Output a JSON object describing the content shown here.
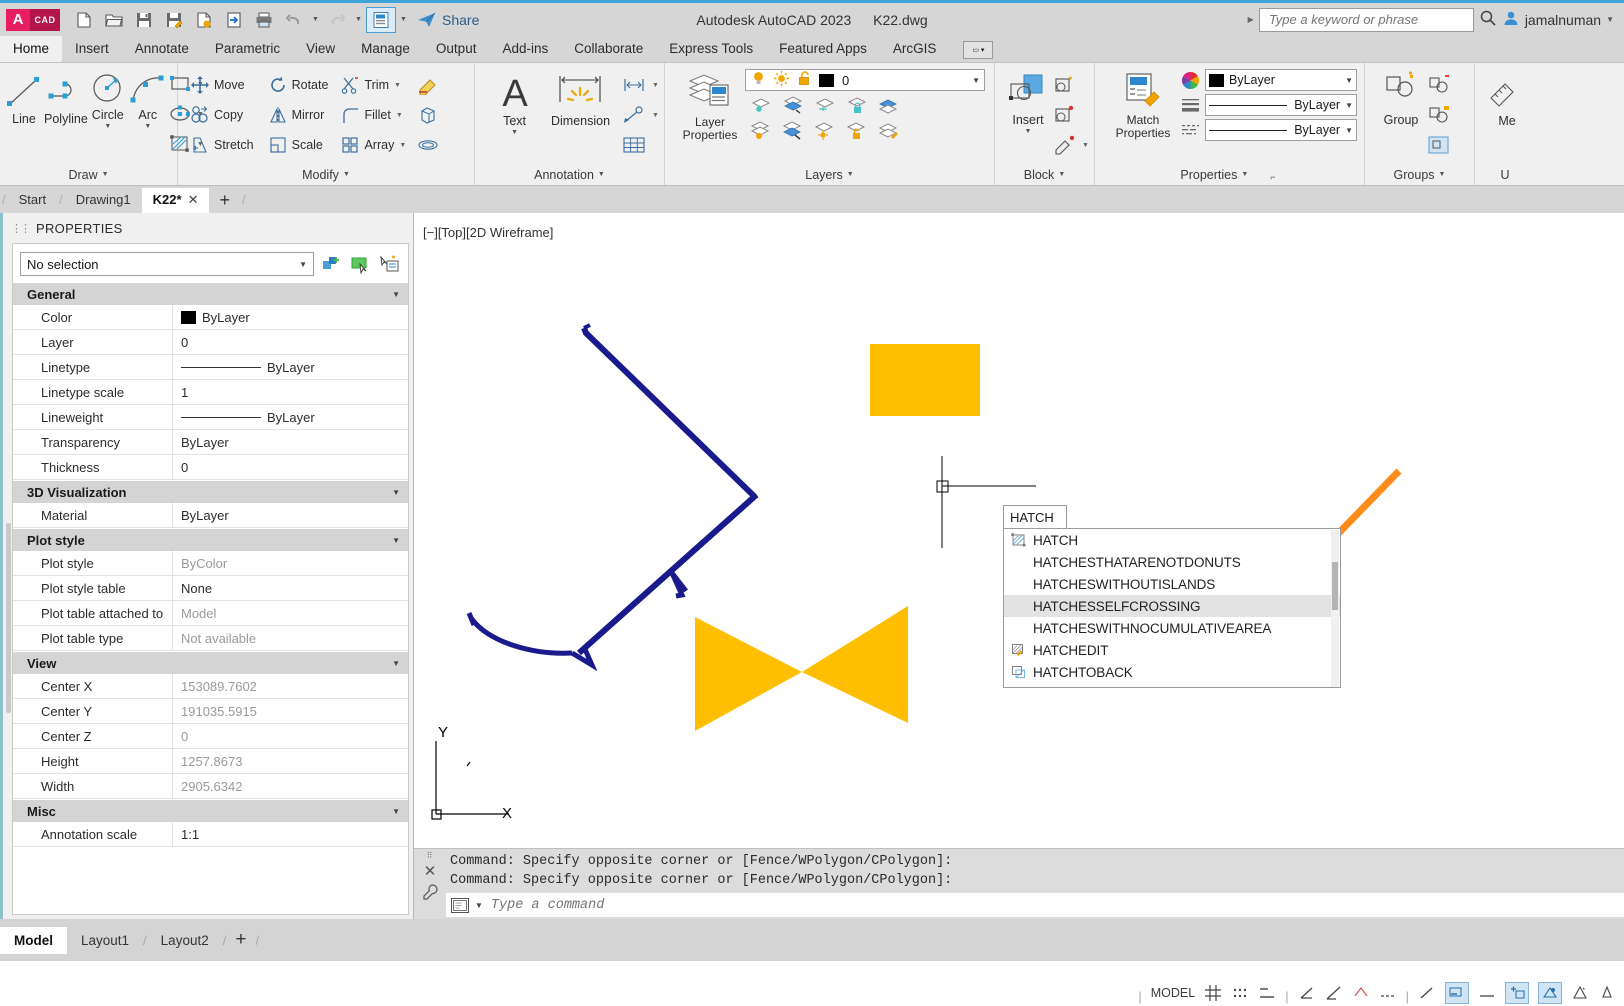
{
  "titlebar": {
    "app_name": "AutoCAD",
    "logo_a": "A",
    "logo_cad": "CAD",
    "title_app": "Autodesk AutoCAD 2023",
    "title_file": "K22.dwg",
    "share_label": "Share",
    "search_placeholder": "Type a keyword or phrase",
    "username": "jamalnuman",
    "quick_access": [
      {
        "name": "new-file-icon",
        "label": "New"
      },
      {
        "name": "open-file-icon",
        "label": "Open"
      },
      {
        "name": "save-icon",
        "label": "Save"
      },
      {
        "name": "save-as-icon",
        "label": "Save As"
      },
      {
        "name": "export-icon",
        "label": "Export"
      },
      {
        "name": "publish-icon",
        "label": "Publish"
      },
      {
        "name": "plot-icon",
        "label": "Plot"
      },
      {
        "name": "undo-icon",
        "label": "Undo"
      },
      {
        "name": "redo-icon",
        "label": "Redo"
      },
      {
        "name": "workspace-icon",
        "label": "Workspace Switching"
      }
    ]
  },
  "ribbon_tabs": [
    {
      "label": "Home",
      "active": true
    },
    {
      "label": "Insert",
      "active": false
    },
    {
      "label": "Annotate",
      "active": false
    },
    {
      "label": "Parametric",
      "active": false
    },
    {
      "label": "View",
      "active": false
    },
    {
      "label": "Manage",
      "active": false
    },
    {
      "label": "Output",
      "active": false
    },
    {
      "label": "Add-ins",
      "active": false
    },
    {
      "label": "Collaborate",
      "active": false
    },
    {
      "label": "Express Tools",
      "active": false
    },
    {
      "label": "Featured Apps",
      "active": false
    },
    {
      "label": "ArcGIS",
      "active": false
    }
  ],
  "ribbon": {
    "draw": {
      "title": "Draw",
      "big": [
        {
          "label": "Line",
          "icon": "line-icon",
          "has_caret": false
        },
        {
          "label": "Polyline",
          "icon": "polyline-icon",
          "has_caret": false
        },
        {
          "label": "Circle",
          "icon": "circle-icon",
          "has_caret": true
        },
        {
          "label": "Arc",
          "icon": "arc-icon",
          "has_caret": true
        }
      ],
      "small": [
        {
          "label": "",
          "icon": "rectangle-icon"
        },
        {
          "label": "",
          "icon": "ellipse-icon"
        },
        {
          "label": "",
          "icon": "hatch-icon"
        }
      ]
    },
    "modify": {
      "title": "Modify",
      "items": [
        {
          "label": "Move",
          "icon": "move-icon",
          "caret": false
        },
        {
          "label": "Rotate",
          "icon": "rotate-icon",
          "caret": false
        },
        {
          "label": "Trim",
          "icon": "trim-icon",
          "caret": true
        },
        {
          "label": "Copy",
          "icon": "copy-icon",
          "caret": false
        },
        {
          "label": "Mirror",
          "icon": "mirror-icon",
          "caret": false
        },
        {
          "label": "Fillet",
          "icon": "fillet-icon",
          "caret": true
        },
        {
          "label": "Stretch",
          "icon": "stretch-icon",
          "caret": false
        },
        {
          "label": "Scale",
          "icon": "scale-icon",
          "caret": false
        },
        {
          "label": "Array",
          "icon": "array-icon",
          "caret": true
        }
      ],
      "extra": [
        {
          "icon": "erase-icon"
        },
        {
          "icon": "extrude-icon"
        },
        {
          "icon": "offset-icon"
        }
      ]
    },
    "annotation": {
      "title": "Annotation",
      "text_label": "Text",
      "dimension_label": "Dimension",
      "small": [
        {
          "icon": "linear-dimension-icon",
          "caret": true
        },
        {
          "icon": "leader-icon",
          "caret": true
        },
        {
          "icon": "table-icon",
          "caret": false
        }
      ]
    },
    "layers": {
      "title": "Layers",
      "layer_properties_label": "Layer\nProperties",
      "current_layer": "0",
      "row1": [
        "layer-isolate-icon",
        "layer-freeze-icon",
        "layer-off-icon",
        "layer-lock-icon",
        "layer-make-current-icon"
      ],
      "row2": [
        "layer-on-icon",
        "layer-thaw-icon",
        "layer-unisolate-icon",
        "layer-unlock-icon",
        "layer-match-icon"
      ]
    },
    "block": {
      "title": "Block",
      "insert_label": "Insert",
      "small": [
        {
          "icon": "create-block-icon"
        },
        {
          "icon": "edit-block-icon"
        },
        {
          "icon": "edit-attribute-icon",
          "caret": true
        }
      ]
    },
    "properties": {
      "title": "Properties",
      "match_properties_label": "Match\nProperties",
      "color_value": "ByLayer",
      "linetype_value": "ByLayer",
      "lineweight_value": "ByLayer",
      "color_icon": "color-wheel-icon",
      "lineweight_icon": "lineweight-icon",
      "linetype_icon": "linetype-icon"
    },
    "groups": {
      "title": "Groups",
      "group_label": "Group",
      "small": [
        {
          "icon": "ungroup-icon"
        },
        {
          "icon": "group-edit-icon"
        },
        {
          "icon": "group-selection-icon"
        }
      ]
    },
    "utilities": {
      "title": "U",
      "measure_label": "Me"
    }
  },
  "file_tabs": [
    {
      "label": "Start",
      "active": false,
      "closable": false
    },
    {
      "label": "Drawing1",
      "active": false,
      "closable": false
    },
    {
      "label": "K22*",
      "active": true,
      "closable": true
    }
  ],
  "palette": {
    "title": "PROPERTIES",
    "selection": "No selection",
    "tool_icons": [
      "quick-select-icon",
      "select-objects-icon",
      "toggle-palette-icon"
    ],
    "groups": [
      {
        "name": "General",
        "rows": [
          {
            "key": "Color",
            "value": "ByLayer",
            "type": "swatch",
            "dim": false
          },
          {
            "key": "Layer",
            "value": "0",
            "type": "text",
            "dim": false
          },
          {
            "key": "Linetype",
            "value": "ByLayer",
            "type": "line",
            "dim": false
          },
          {
            "key": "Linetype scale",
            "value": "1",
            "type": "text",
            "dim": false
          },
          {
            "key": "Lineweight",
            "value": "ByLayer",
            "type": "line",
            "dim": false
          },
          {
            "key": "Transparency",
            "value": "ByLayer",
            "type": "text",
            "dim": false
          },
          {
            "key": "Thickness",
            "value": "0",
            "type": "text",
            "dim": false
          }
        ]
      },
      {
        "name": "3D Visualization",
        "rows": [
          {
            "key": "Material",
            "value": "ByLayer",
            "type": "text",
            "dim": false
          }
        ]
      },
      {
        "name": "Plot style",
        "rows": [
          {
            "key": "Plot style",
            "value": "ByColor",
            "type": "text",
            "dim": true
          },
          {
            "key": "Plot style table",
            "value": "None",
            "type": "text",
            "dim": false
          },
          {
            "key": "Plot table attached to",
            "value": "Model",
            "type": "text",
            "dim": true
          },
          {
            "key": "Plot table type",
            "value": "Not available",
            "type": "text",
            "dim": true
          }
        ]
      },
      {
        "name": "View",
        "rows": [
          {
            "key": "Center X",
            "value": "153089.7602",
            "type": "text",
            "dim": true
          },
          {
            "key": "Center Y",
            "value": "191035.5915",
            "type": "text",
            "dim": true
          },
          {
            "key": "Center Z",
            "value": "0",
            "type": "text",
            "dim": true
          },
          {
            "key": "Height",
            "value": "1257.8673",
            "type": "text",
            "dim": true
          },
          {
            "key": "Width",
            "value": "2905.6342",
            "type": "text",
            "dim": true
          }
        ]
      },
      {
        "name": "Misc",
        "rows": [
          {
            "key": "Annotation scale",
            "value": "1:1",
            "type": "text",
            "dim": false
          }
        ]
      }
    ]
  },
  "canvas": {
    "view_label": "[−][Top][2D Wireframe]",
    "ucs_x_label": "X",
    "ucs_y_label": "Y",
    "colors": {
      "polyline_blue": "#1a1a8c",
      "hatch_yellow": "#ffbf00",
      "polyline_orange": "#ff8c1a",
      "crosshair": "#000000"
    }
  },
  "autocomplete": {
    "typed": "HATCH",
    "items": [
      {
        "label": "HATCH",
        "icon": "hatch-icon",
        "selected": false
      },
      {
        "label": "HATCHESTHATARENOTDONUTS",
        "icon": "",
        "selected": false
      },
      {
        "label": "HATCHESWITHOUTISLANDS",
        "icon": "",
        "selected": false
      },
      {
        "label": "HATCHESSELFCROSSING",
        "icon": "",
        "selected": true
      },
      {
        "label": "HATCHESWITHNOCUMULATIVEAREA",
        "icon": "",
        "selected": false
      },
      {
        "label": "HATCHEDIT",
        "icon": "hatchedit-icon",
        "selected": false
      },
      {
        "label": "HATCHTOBACK",
        "icon": "hatchtoback-icon",
        "selected": false
      }
    ]
  },
  "command_line": {
    "history": [
      "Command: Specify opposite corner or [Fence/WPolygon/CPolygon]:",
      "Command: Specify opposite corner or [Fence/WPolygon/CPolygon]:"
    ],
    "placeholder": "Type a command"
  },
  "layout_tabs": [
    {
      "label": "Model",
      "active": true
    },
    {
      "label": "Layout1",
      "active": false
    },
    {
      "label": "Layout2",
      "active": false
    }
  ],
  "status_bar": {
    "model_label": "MODEL",
    "toggles": [
      "grid-display-icon",
      "snap-mode-icon",
      "infer-constraints-icon",
      "ortho-mode-icon",
      "polar-tracking-icon",
      "isometric-drafting-icon",
      "object-snap-tracking-icon",
      "object-snap-icon",
      "lineweight-icon",
      "transparency-icon",
      "selection-cycling-icon",
      "3d-object-snap-icon",
      "dynamic-ucs-icon",
      "selection-filtering-icon",
      "gizmo-icon",
      "annotation-visibility-icon",
      "autoscale-icon"
    ]
  }
}
